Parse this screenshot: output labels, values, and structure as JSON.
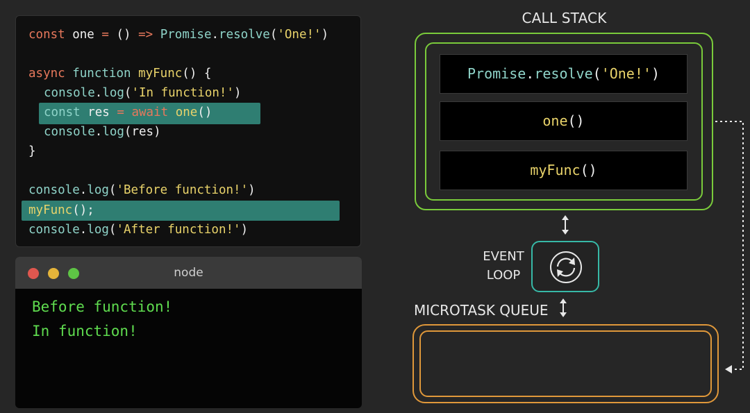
{
  "code": {
    "line1": {
      "kw": "const",
      "name": "one",
      "op": "=",
      "arrow_params": "()",
      "arrow": "=>",
      "obj": "Promise",
      "dot": ".",
      "method": "resolve",
      "paren_open": "(",
      "str": "'One!'",
      "paren_close": ")"
    },
    "line3": {
      "kw": "async",
      "kw2": "function",
      "name": "myFunc",
      "rest": "() {"
    },
    "line4": {
      "obj": "console",
      "dot": ".",
      "method": "log",
      "paren_open": "(",
      "str": "'In function!'",
      "paren_close": ")"
    },
    "line5": {
      "kw": "const",
      "name": "res",
      "op": "=",
      "await": "await",
      "call": "one",
      "parens": "()"
    },
    "line6": {
      "obj": "console",
      "dot": ".",
      "method": "log",
      "args": "(res)"
    },
    "line7": {
      "brace": "}"
    },
    "line9": {
      "obj": "console",
      "dot": ".",
      "method": "log",
      "paren_open": "(",
      "str": "'Before function!'",
      "paren_close": ")"
    },
    "line10": {
      "call": "myFunc",
      "rest": "();"
    },
    "line11": {
      "obj": "console",
      "dot": ".",
      "method": "log",
      "paren_open": "(",
      "str": "'After function!'",
      "paren_close": ")"
    }
  },
  "terminal": {
    "title": "node",
    "lines": [
      "Before function!",
      "In function!"
    ],
    "dot_colors": [
      "#e0574f",
      "#e5b43a",
      "#5ec445"
    ]
  },
  "call_stack": {
    "label": "CALL STACK",
    "frames": [
      {
        "a": "Promise",
        "b": ".",
        "c": "resolve",
        "d": "(",
        "e": "'One!'",
        "f": ")"
      },
      {
        "a": "one",
        "b": "()"
      },
      {
        "a": "myFunc",
        "b": "()"
      }
    ]
  },
  "event_loop": {
    "line1": "EVENT",
    "line2": "LOOP",
    "icon": "refresh-cycle-icon"
  },
  "microtask_queue": {
    "label": "MICROTASK QUEUE"
  },
  "colors": {
    "call_stack_border": "#7acb3b",
    "event_loop_border": "#37b9a7",
    "microtask_border": "#e0983a",
    "highlight": "#2f7e72",
    "terminal_text": "#5fdc4f"
  }
}
